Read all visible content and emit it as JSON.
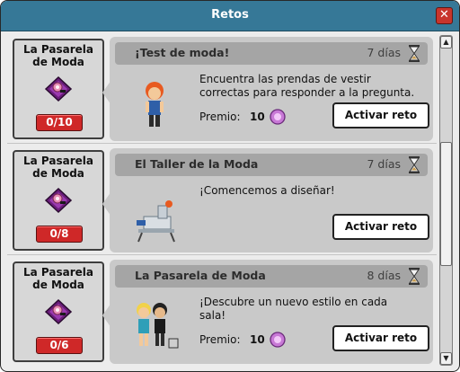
{
  "window": {
    "title": "Retos"
  },
  "quests": [
    {
      "category": "La Pasarela de Moda",
      "progress": "0/10",
      "title": "¡Test de moda!",
      "days": "7 días",
      "description": "Encuentra las prendas de vestir correctas para responder a la pregunta.",
      "prize_label": "Premio:",
      "prize_value": "10",
      "button": "Activar reto"
    },
    {
      "category": "La Pasarela de Moda",
      "progress": "0/8",
      "title": "El Taller de la Moda",
      "days": "7 días",
      "description": "¡Comencemos a diseñar!",
      "button": "Activar reto"
    },
    {
      "category": "La Pasarela de Moda",
      "progress": "0/6",
      "title": "La Pasarela de Moda",
      "days": "8 días",
      "description": "¡Descubre un nuevo estilo en cada sala!",
      "prize_label": "Premio:",
      "prize_value": "10",
      "button": "Activar reto"
    }
  ],
  "colors": {
    "titlebar": "#367897",
    "progress_badge": "#cf2828",
    "card": "#c9c9c9",
    "card_header": "#a5a5a5"
  },
  "icons": {
    "close": "close-icon",
    "category": "fashion-runway-icon",
    "timer": "hourglass-icon",
    "prize": "pixel-currency-icon"
  }
}
